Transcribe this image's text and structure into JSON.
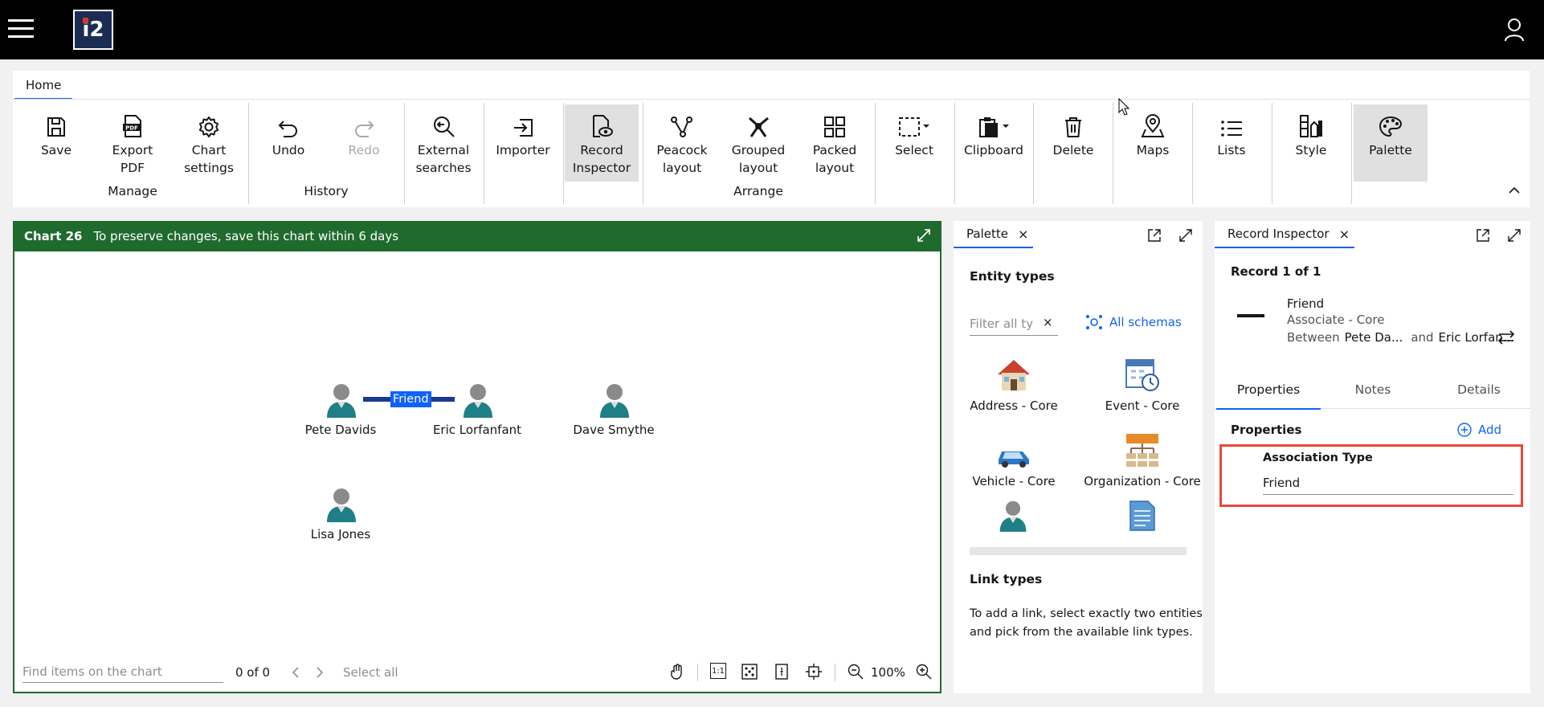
{
  "ribbon": {
    "home_tab": "Home",
    "buttons": {
      "save": "Save",
      "export1": "Export",
      "export2": "PDF",
      "chartset1": "Chart",
      "chartset2": "settings",
      "undo": "Undo",
      "redo": "Redo",
      "ext1": "External",
      "ext2": "searches",
      "importer": "Importer",
      "rec1": "Record",
      "rec2": "Inspector",
      "peacock1": "Peacock",
      "peacock2": "layout",
      "grouped1": "Grouped",
      "grouped2": "layout",
      "packed1": "Packed",
      "packed2": "layout",
      "select": "Select",
      "clipboard": "Clipboard",
      "delete": "Delete",
      "maps": "Maps",
      "lists": "Lists",
      "style": "Style",
      "palette": "Palette"
    },
    "groups": {
      "manage": "Manage",
      "history": "History",
      "arrange": "Arrange"
    }
  },
  "chart": {
    "name": "Chart 26",
    "notice": "To preserve changes, save this chart within 6 days",
    "nodes": [
      "Pete Davids",
      "Eric Lorfanfant",
      "Dave Smythe",
      "Lisa Jones"
    ],
    "link_label": "Friend",
    "find_placeholder": "Find items on the chart",
    "count": "0 of 0",
    "select_all": "Select all",
    "one_to_one": "1:1",
    "zoom": "100%"
  },
  "palette": {
    "tab": "Palette",
    "entity_types_title": "Entity types",
    "filter_placeholder": "Filter all ty",
    "all_schemas": "All schemas",
    "types": [
      "Address - Core",
      "Event - Core",
      "Vehicle - Core",
      "Organization - Core"
    ],
    "link_types_title": "Link types",
    "link_help_1": "To add a link, select exactly two entities",
    "link_help_2": "and pick from the available link types."
  },
  "inspector": {
    "tab": "Record Inspector",
    "record_count": "Record 1 of 1",
    "record_title": "Friend",
    "record_type": "Associate - Core",
    "between": "Between",
    "end1": "Pete Da...",
    "and": "and",
    "end2": "Eric Lorfan...",
    "tabs": [
      "Properties",
      "Notes",
      "Details"
    ],
    "properties_title": "Properties",
    "add": "Add",
    "field_label": "Association Type",
    "field_value": "Friend"
  },
  "colors": {
    "header_green": "#1f6b2e",
    "accent_blue": "#0f62fe",
    "highlight_red": "#e8473b"
  }
}
